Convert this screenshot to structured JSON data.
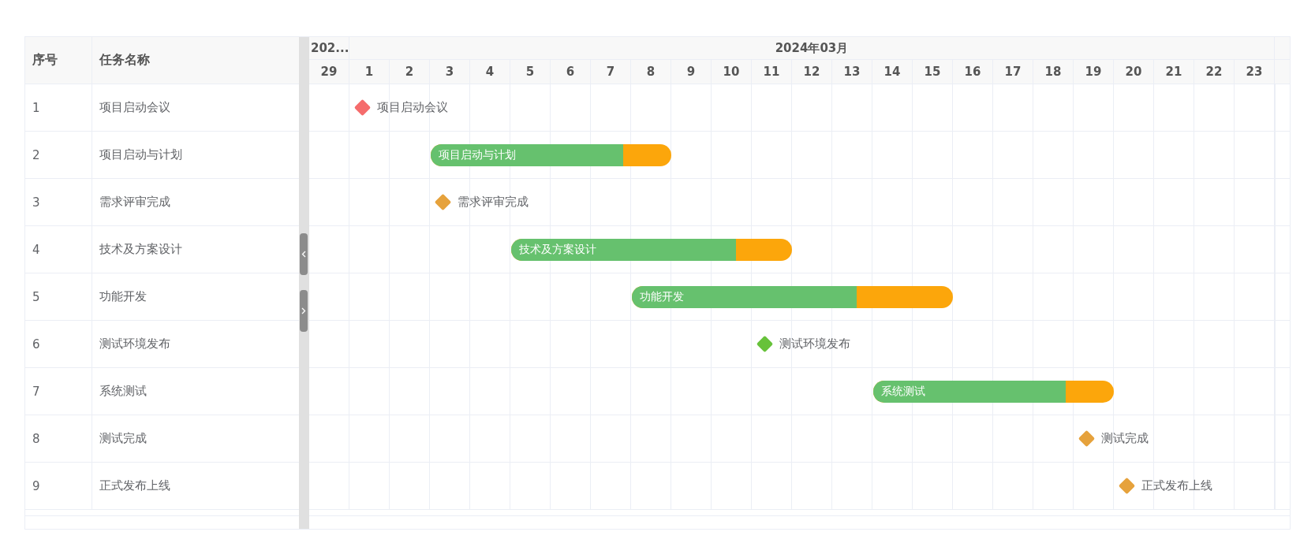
{
  "table": {
    "columns": [
      "序号",
      "任务名称"
    ]
  },
  "timeline": {
    "months": [
      {
        "label": "202...",
        "days": [
          "29"
        ]
      },
      {
        "label": "2024年03月",
        "days": [
          "1",
          "2",
          "3",
          "4",
          "5",
          "6",
          "7",
          "8",
          "9",
          "10",
          "11",
          "12",
          "13",
          "14",
          "15",
          "16",
          "17",
          "18",
          "19",
          "20",
          "21",
          "22",
          "23"
        ]
      }
    ]
  },
  "tasks": [
    {
      "index": "1",
      "name": "项目启动会议",
      "kind": "milestone",
      "label": "项目启动会议",
      "color": "#f56c6c",
      "cells": [
        {
          "kind": "empty"
        },
        {
          "kind": "milestone"
        },
        {
          "kind": "empty"
        },
        {
          "kind": "empty"
        },
        {
          "kind": "empty"
        },
        {
          "kind": "empty"
        },
        {
          "kind": "empty"
        },
        {
          "kind": "empty"
        },
        {
          "kind": "empty"
        },
        {
          "kind": "empty"
        },
        {
          "kind": "empty"
        },
        {
          "kind": "empty"
        },
        {
          "kind": "empty"
        },
        {
          "kind": "empty"
        },
        {
          "kind": "empty"
        },
        {
          "kind": "empty"
        },
        {
          "kind": "empty"
        },
        {
          "kind": "empty"
        },
        {
          "kind": "empty"
        },
        {
          "kind": "empty"
        },
        {
          "kind": "empty"
        },
        {
          "kind": "empty"
        },
        {
          "kind": "empty"
        },
        {
          "kind": "empty"
        }
      ]
    },
    {
      "index": "2",
      "name": "项目启动与计划",
      "kind": "bar",
      "label": "项目启动与计划",
      "level": 0.8,
      "cells": [
        {
          "kind": "empty"
        },
        {
          "kind": "empty"
        },
        {
          "kind": "empty"
        },
        {
          "kind": "bar"
        },
        {
          "kind": "bar"
        },
        {
          "kind": "bar"
        },
        {
          "kind": "bar"
        },
        {
          "kind": "bar"
        },
        {
          "kind": "bar"
        },
        {
          "kind": "empty"
        },
        {
          "kind": "empty"
        },
        {
          "kind": "empty"
        },
        {
          "kind": "empty"
        },
        {
          "kind": "empty"
        },
        {
          "kind": "empty"
        },
        {
          "kind": "empty"
        },
        {
          "kind": "empty"
        },
        {
          "kind": "empty"
        },
        {
          "kind": "empty"
        },
        {
          "kind": "empty"
        },
        {
          "kind": "empty"
        },
        {
          "kind": "empty"
        },
        {
          "kind": "empty"
        },
        {
          "kind": "empty"
        }
      ]
    },
    {
      "index": "3",
      "name": "需求评审完成",
      "kind": "milestone",
      "label": "需求评审完成",
      "color": "#e6a23c",
      "cells": [
        {
          "kind": "empty"
        },
        {
          "kind": "empty"
        },
        {
          "kind": "empty"
        },
        {
          "kind": "milestone"
        },
        {
          "kind": "empty"
        },
        {
          "kind": "empty"
        },
        {
          "kind": "empty"
        },
        {
          "kind": "empty"
        },
        {
          "kind": "empty"
        },
        {
          "kind": "empty"
        },
        {
          "kind": "empty"
        },
        {
          "kind": "empty"
        },
        {
          "kind": "empty"
        },
        {
          "kind": "empty"
        },
        {
          "kind": "empty"
        },
        {
          "kind": "empty"
        },
        {
          "kind": "empty"
        },
        {
          "kind": "empty"
        },
        {
          "kind": "empty"
        },
        {
          "kind": "empty"
        },
        {
          "kind": "empty"
        },
        {
          "kind": "empty"
        },
        {
          "kind": "empty"
        },
        {
          "kind": "empty"
        }
      ]
    },
    {
      "index": "4",
      "name": "技术及方案设计",
      "kind": "bar",
      "label": "技术及方案设计",
      "level": 0.8,
      "cells": [
        {
          "kind": "empty"
        },
        {
          "kind": "empty"
        },
        {
          "kind": "empty"
        },
        {
          "kind": "empty"
        },
        {
          "kind": "empty"
        },
        {
          "kind": "bar"
        },
        {
          "kind": "bar"
        },
        {
          "kind": "bar"
        },
        {
          "kind": "bar"
        },
        {
          "kind": "bar"
        },
        {
          "kind": "bar"
        },
        {
          "kind": "bar"
        },
        {
          "kind": "empty"
        },
        {
          "kind": "empty"
        },
        {
          "kind": "empty"
        },
        {
          "kind": "empty"
        },
        {
          "kind": "empty"
        },
        {
          "kind": "empty"
        },
        {
          "kind": "empty"
        },
        {
          "kind": "empty"
        },
        {
          "kind": "empty"
        },
        {
          "kind": "empty"
        },
        {
          "kind": "empty"
        },
        {
          "kind": "empty"
        }
      ]
    },
    {
      "index": "5",
      "name": "功能开发",
      "kind": "bar",
      "label": "功能开发",
      "level": 0.7,
      "cells": [
        {
          "kind": "empty"
        },
        {
          "kind": "empty"
        },
        {
          "kind": "empty"
        },
        {
          "kind": "empty"
        },
        {
          "kind": "empty"
        },
        {
          "kind": "empty"
        },
        {
          "kind": "empty"
        },
        {
          "kind": "empty"
        },
        {
          "kind": "bar"
        },
        {
          "kind": "bar"
        },
        {
          "kind": "bar"
        },
        {
          "kind": "bar"
        },
        {
          "kind": "bar"
        },
        {
          "kind": "bar"
        },
        {
          "kind": "bar"
        },
        {
          "kind": "bar"
        },
        {
          "kind": "empty"
        },
        {
          "kind": "empty"
        },
        {
          "kind": "empty"
        },
        {
          "kind": "empty"
        },
        {
          "kind": "empty"
        },
        {
          "kind": "empty"
        },
        {
          "kind": "empty"
        },
        {
          "kind": "empty"
        }
      ]
    },
    {
      "index": "6",
      "name": "测试环境发布",
      "kind": "milestone",
      "label": "测试环境发布",
      "color": "#67c23a",
      "cells": [
        {
          "kind": "empty"
        },
        {
          "kind": "empty"
        },
        {
          "kind": "empty"
        },
        {
          "kind": "empty"
        },
        {
          "kind": "empty"
        },
        {
          "kind": "empty"
        },
        {
          "kind": "empty"
        },
        {
          "kind": "empty"
        },
        {
          "kind": "empty"
        },
        {
          "kind": "empty"
        },
        {
          "kind": "empty"
        },
        {
          "kind": "milestone"
        },
        {
          "kind": "empty"
        },
        {
          "kind": "empty"
        },
        {
          "kind": "empty"
        },
        {
          "kind": "empty"
        },
        {
          "kind": "empty"
        },
        {
          "kind": "empty"
        },
        {
          "kind": "empty"
        },
        {
          "kind": "empty"
        },
        {
          "kind": "empty"
        },
        {
          "kind": "empty"
        },
        {
          "kind": "empty"
        },
        {
          "kind": "empty"
        }
      ]
    },
    {
      "index": "7",
      "name": "系统测试",
      "kind": "bar",
      "label": "系统测试",
      "level": 0.8,
      "cells": [
        {
          "kind": "empty"
        },
        {
          "kind": "empty"
        },
        {
          "kind": "empty"
        },
        {
          "kind": "empty"
        },
        {
          "kind": "empty"
        },
        {
          "kind": "empty"
        },
        {
          "kind": "empty"
        },
        {
          "kind": "empty"
        },
        {
          "kind": "empty"
        },
        {
          "kind": "empty"
        },
        {
          "kind": "empty"
        },
        {
          "kind": "empty"
        },
        {
          "kind": "empty"
        },
        {
          "kind": "empty"
        },
        {
          "kind": "bar"
        },
        {
          "kind": "bar"
        },
        {
          "kind": "bar"
        },
        {
          "kind": "bar"
        },
        {
          "kind": "bar"
        },
        {
          "kind": "bar"
        },
        {
          "kind": "empty"
        },
        {
          "kind": "empty"
        },
        {
          "kind": "empty"
        },
        {
          "kind": "empty"
        }
      ]
    },
    {
      "index": "8",
      "name": "测试完成",
      "kind": "milestone",
      "label": "测试完成",
      "color": "#e6a23c",
      "cells": [
        {
          "kind": "empty"
        },
        {
          "kind": "empty"
        },
        {
          "kind": "empty"
        },
        {
          "kind": "empty"
        },
        {
          "kind": "empty"
        },
        {
          "kind": "empty"
        },
        {
          "kind": "empty"
        },
        {
          "kind": "empty"
        },
        {
          "kind": "empty"
        },
        {
          "kind": "empty"
        },
        {
          "kind": "empty"
        },
        {
          "kind": "empty"
        },
        {
          "kind": "empty"
        },
        {
          "kind": "empty"
        },
        {
          "kind": "empty"
        },
        {
          "kind": "empty"
        },
        {
          "kind": "empty"
        },
        {
          "kind": "empty"
        },
        {
          "kind": "empty"
        },
        {
          "kind": "milestone"
        },
        {
          "kind": "empty"
        },
        {
          "kind": "empty"
        },
        {
          "kind": "empty"
        },
        {
          "kind": "empty"
        }
      ]
    },
    {
      "index": "9",
      "name": "正式发布上线",
      "kind": "milestone",
      "label": "正式发布上线",
      "color": "#e6a23c",
      "cells": [
        {
          "kind": "empty"
        },
        {
          "kind": "empty"
        },
        {
          "kind": "empty"
        },
        {
          "kind": "empty"
        },
        {
          "kind": "empty"
        },
        {
          "kind": "empty"
        },
        {
          "kind": "empty"
        },
        {
          "kind": "empty"
        },
        {
          "kind": "empty"
        },
        {
          "kind": "empty"
        },
        {
          "kind": "empty"
        },
        {
          "kind": "empty"
        },
        {
          "kind": "empty"
        },
        {
          "kind": "empty"
        },
        {
          "kind": "empty"
        },
        {
          "kind": "empty"
        },
        {
          "kind": "empty"
        },
        {
          "kind": "empty"
        },
        {
          "kind": "empty"
        },
        {
          "kind": "empty"
        },
        {
          "kind": "milestone"
        },
        {
          "kind": "empty"
        },
        {
          "kind": "empty"
        },
        {
          "kind": "empty"
        }
      ]
    }
  ]
}
